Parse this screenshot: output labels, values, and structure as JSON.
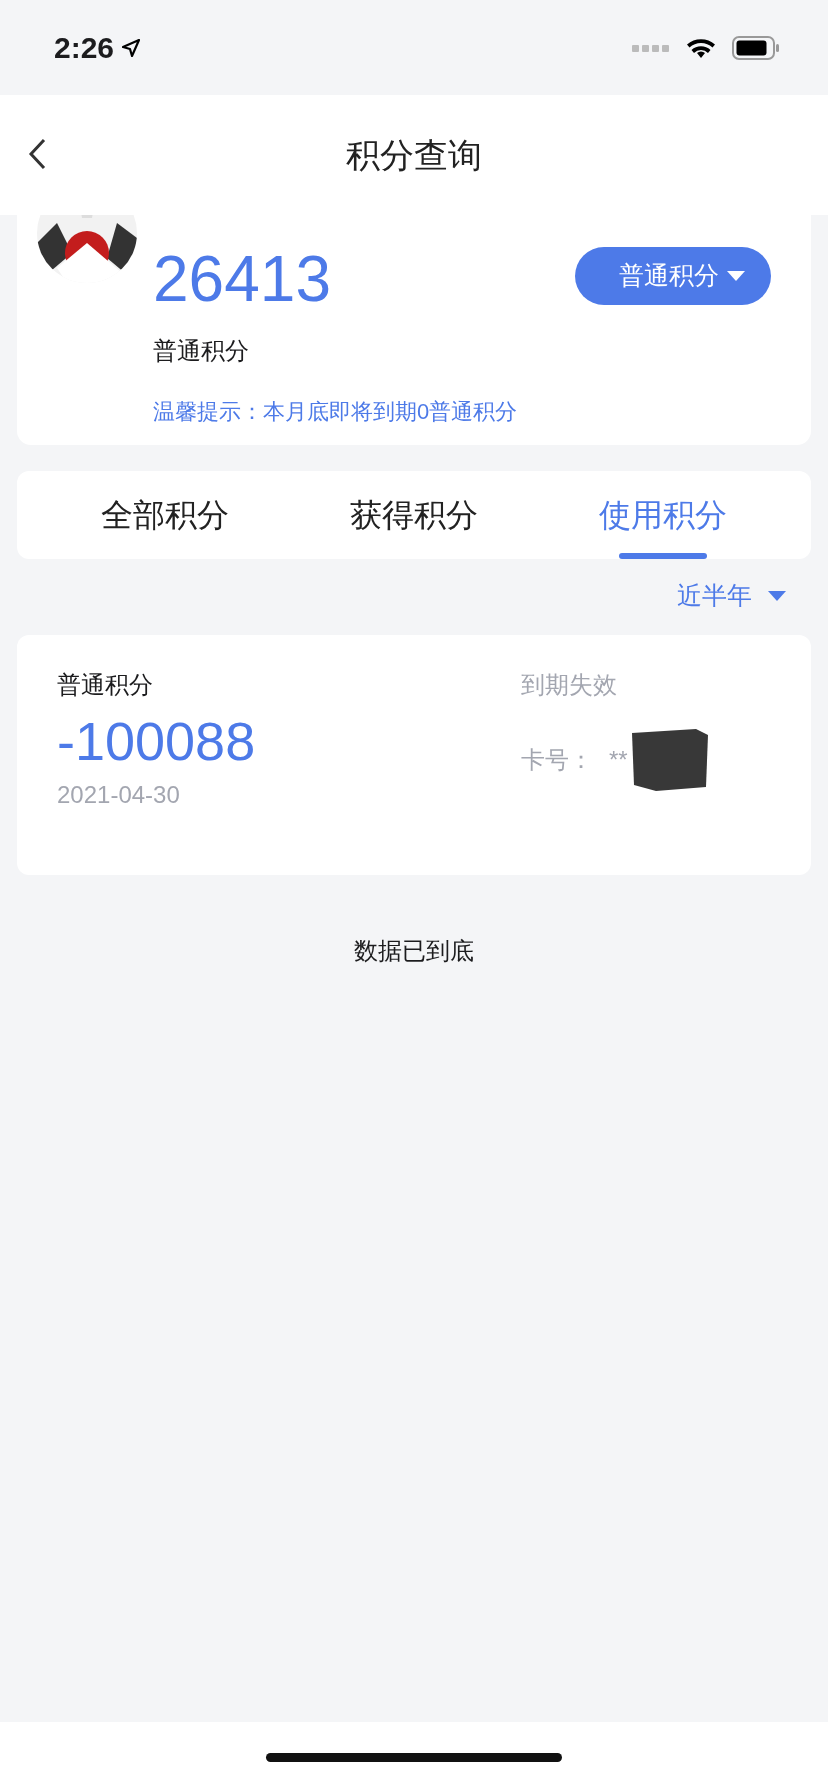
{
  "status_bar": {
    "time": "2:26"
  },
  "nav": {
    "title": "积分查询"
  },
  "summary": {
    "points": "26413",
    "points_label": "普通积分",
    "type_button": "普通积分",
    "hint": "温馨提示：本月底即将到期0普通积分"
  },
  "tabs": [
    {
      "label": "全部积分",
      "selected": false
    },
    {
      "label": "获得积分",
      "selected": false
    },
    {
      "label": "使用积分",
      "selected": true
    }
  ],
  "filter": {
    "label": "近半年"
  },
  "records": [
    {
      "type": "普通积分",
      "amount": "-100088",
      "date": "2021-04-30",
      "status": "到期失效",
      "card_label": "卡号：",
      "card_number": "**"
    }
  ],
  "footer": "数据已到底"
}
